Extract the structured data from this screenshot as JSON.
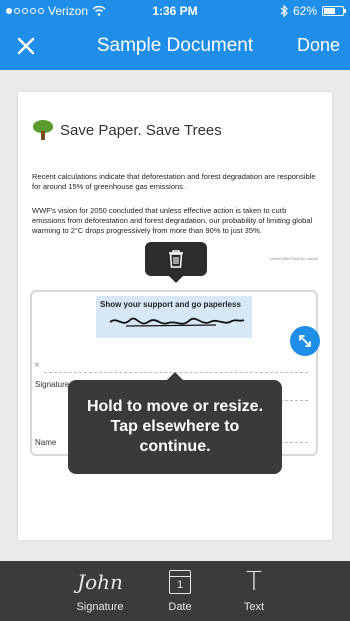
{
  "status": {
    "carrier": "Verizon",
    "time": "1:36 PM",
    "battery": "62%",
    "battery_level": 0.62
  },
  "nav": {
    "title": "Sample Document",
    "done_label": "Done",
    "close_icon": "close-icon"
  },
  "document": {
    "heading": "Save Paper. Save Trees",
    "paragraph1": "Recent calculations indicate that deforestation and forest degradation are responsible for around 15% of greenhouse gas emissions.",
    "paragraph2": "WWF's vision for 2050 concluded that unless effective action is taken to curb emissions from deforestation and forest degradation, our probability of limiting global warming to 2°C drops progressively from more than 90% to just 35%.",
    "credit": "- World Wild Fund for nature",
    "support_text": "Show your support and go paperless",
    "signature_label": "Signature",
    "name_label": "Name",
    "x_mark": "×"
  },
  "tooltip": {
    "text": "Hold to move or resize. Tap elsewhere to continue."
  },
  "toolbar": {
    "signature_label": "Signature",
    "date_label": "Date",
    "date_number": "1",
    "text_label": "Text",
    "text_glyph": "T",
    "signature_glyph": "John"
  },
  "colors": {
    "accent": "#1e8ee8",
    "toolbar_bg": "#3b3b3d",
    "tooltip_bg": "#3a3a3a"
  }
}
